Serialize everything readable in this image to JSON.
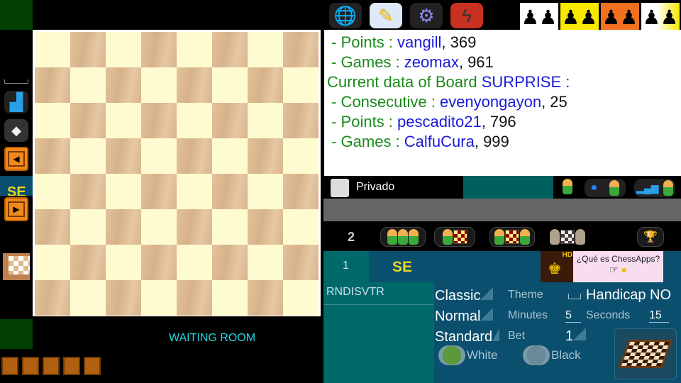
{
  "board": {
    "light": "#fffbd0",
    "dark": "#d9b58c"
  },
  "left_strip": {
    "icons": [
      "armchair-icon",
      "layers-icon",
      "prev-arrow-icon",
      "next-arrow-icon",
      "board-coordinates-icon"
    ],
    "se_label": "SE"
  },
  "waiting_room": "WAITING ROOM",
  "toolbar": {
    "icons": [
      "globe-icon",
      "edit-icon",
      "settings-gear-icon",
      "lightning-icon"
    ],
    "themes": [
      "theme-white",
      "theme-yellow",
      "theme-orange",
      "theme-yellow-white"
    ]
  },
  "info_lines": [
    {
      "prefix": " - Points : ",
      "name": "vangill",
      "value": ", 369"
    },
    {
      "prefix": " - Games : ",
      "name": "zeomax",
      "value": ", 961"
    },
    {
      "heading": "Current data of Board ",
      "board": "SURPRISE :"
    },
    {
      "prefix": " - Consecutive : ",
      "name": "evenyongayon",
      "value": ", 25"
    },
    {
      "prefix": " - Points : ",
      "name": "pescadito21",
      "value": ", 796"
    },
    {
      "prefix": " - Games : ",
      "name": "CalfuCura",
      "value": ", 999"
    }
  ],
  "private_label": "Privado",
  "room_count": "2",
  "table": {
    "number": "1",
    "name": "SE"
  },
  "ad": {
    "text": "¿Qué es ChessApps?",
    "badge": "HD"
  },
  "list": [
    "RNDISVTR"
  ],
  "settings": {
    "type": "Classic",
    "theme_label": "Theme",
    "handicap": "Handicap NO",
    "speed": "Normal",
    "minutes_label": "Minutes",
    "minutes": "5",
    "seconds_label": "Seconds",
    "seconds": "15",
    "variant": "Standard",
    "bet_label": "Bet",
    "bet": "1",
    "white": "White",
    "black": "Black",
    "selected_color": "White"
  }
}
